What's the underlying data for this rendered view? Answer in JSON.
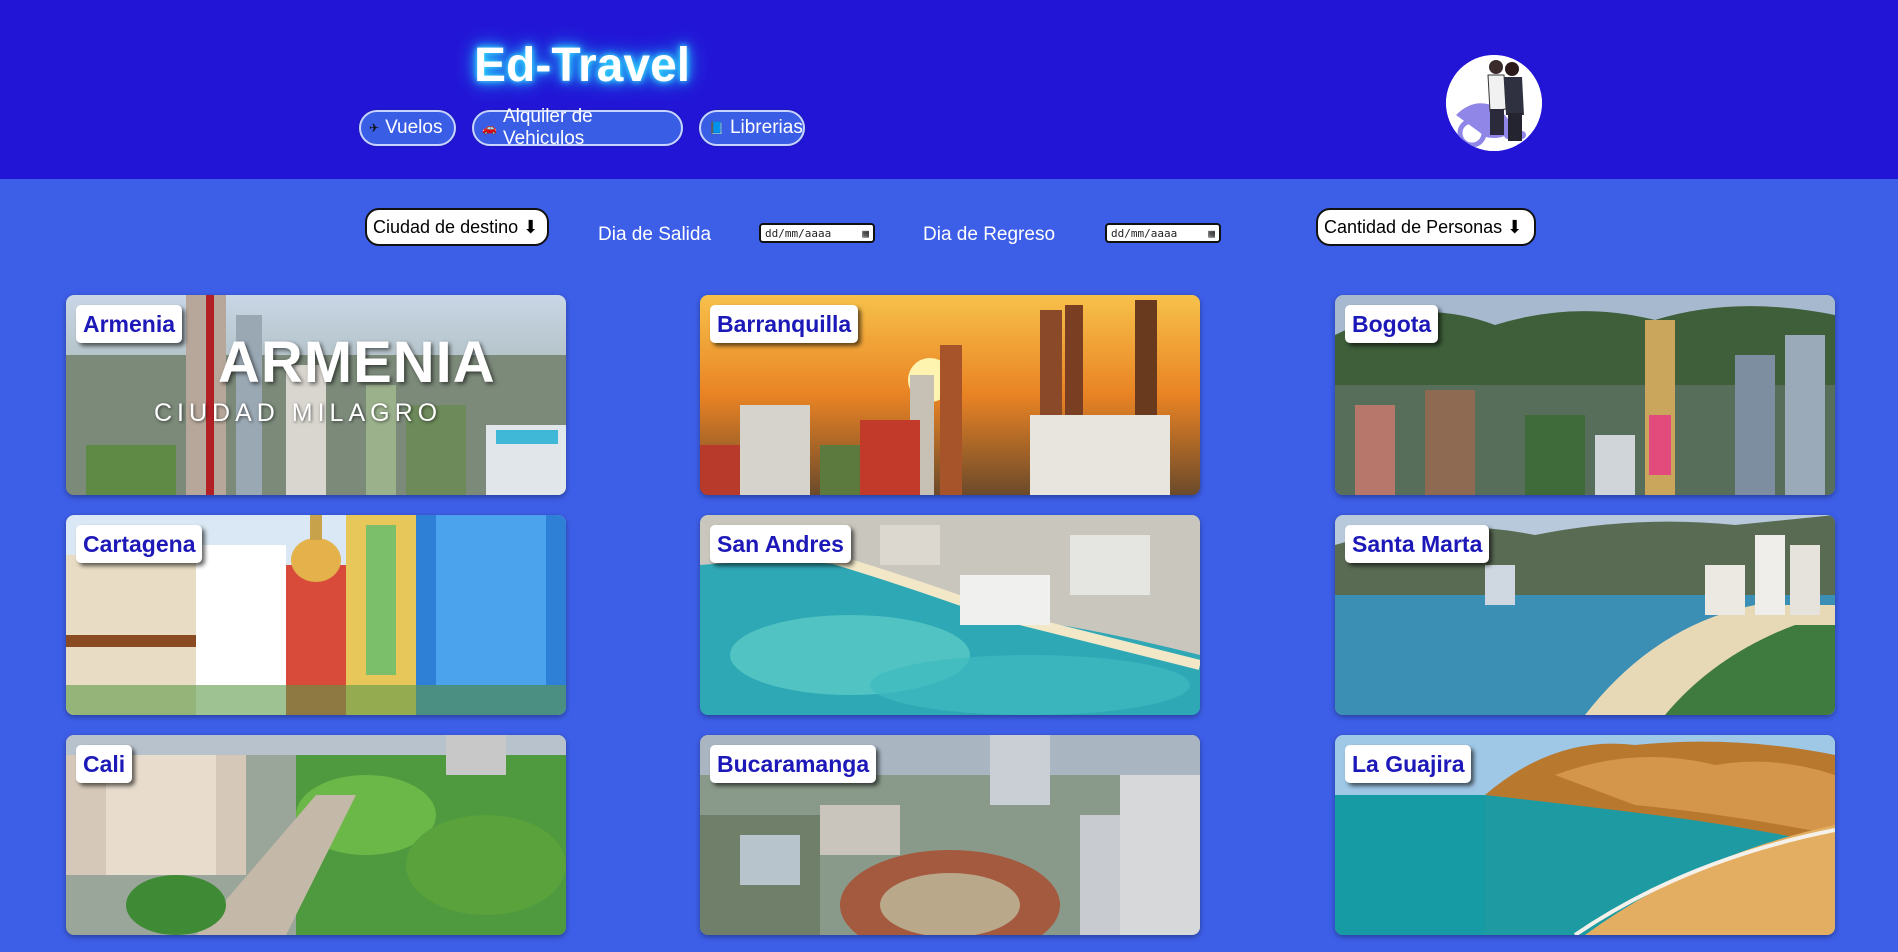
{
  "header": {
    "brand": "Ed-Travel",
    "nav": [
      {
        "label": "Vuelos",
        "icon": "airplane-icon"
      },
      {
        "label": "Alquiler de Vehiculos",
        "icon": "car-icon"
      },
      {
        "label": "Librerias",
        "icon": "book-icon"
      }
    ],
    "avatar_icon": "travelers-avatar"
  },
  "filters": {
    "destination_label": "Ciudad de destino ⬇",
    "departure_label": "Dia de Salida",
    "departure_placeholder": "dd/mm/aaaa",
    "return_label": "Dia de Regreso",
    "return_placeholder": "dd/mm/aaaa",
    "people_label": "Cantidad de Personas ⬇"
  },
  "cities": [
    {
      "name": "Armenia",
      "overlay_title": "ARMENIA",
      "overlay_subtitle": "CIUDAD MILAGRO"
    },
    {
      "name": "Barranquilla"
    },
    {
      "name": "Bogota"
    },
    {
      "name": "Cartagena"
    },
    {
      "name": "San Andres"
    },
    {
      "name": "Santa Marta"
    },
    {
      "name": "Cali"
    },
    {
      "name": "Bucaramanga"
    },
    {
      "name": "La Guajira"
    }
  ],
  "colors": {
    "header_bg": "#2315d6",
    "page_bg": "#3d5fe8",
    "tag_text": "#1d18b8"
  }
}
